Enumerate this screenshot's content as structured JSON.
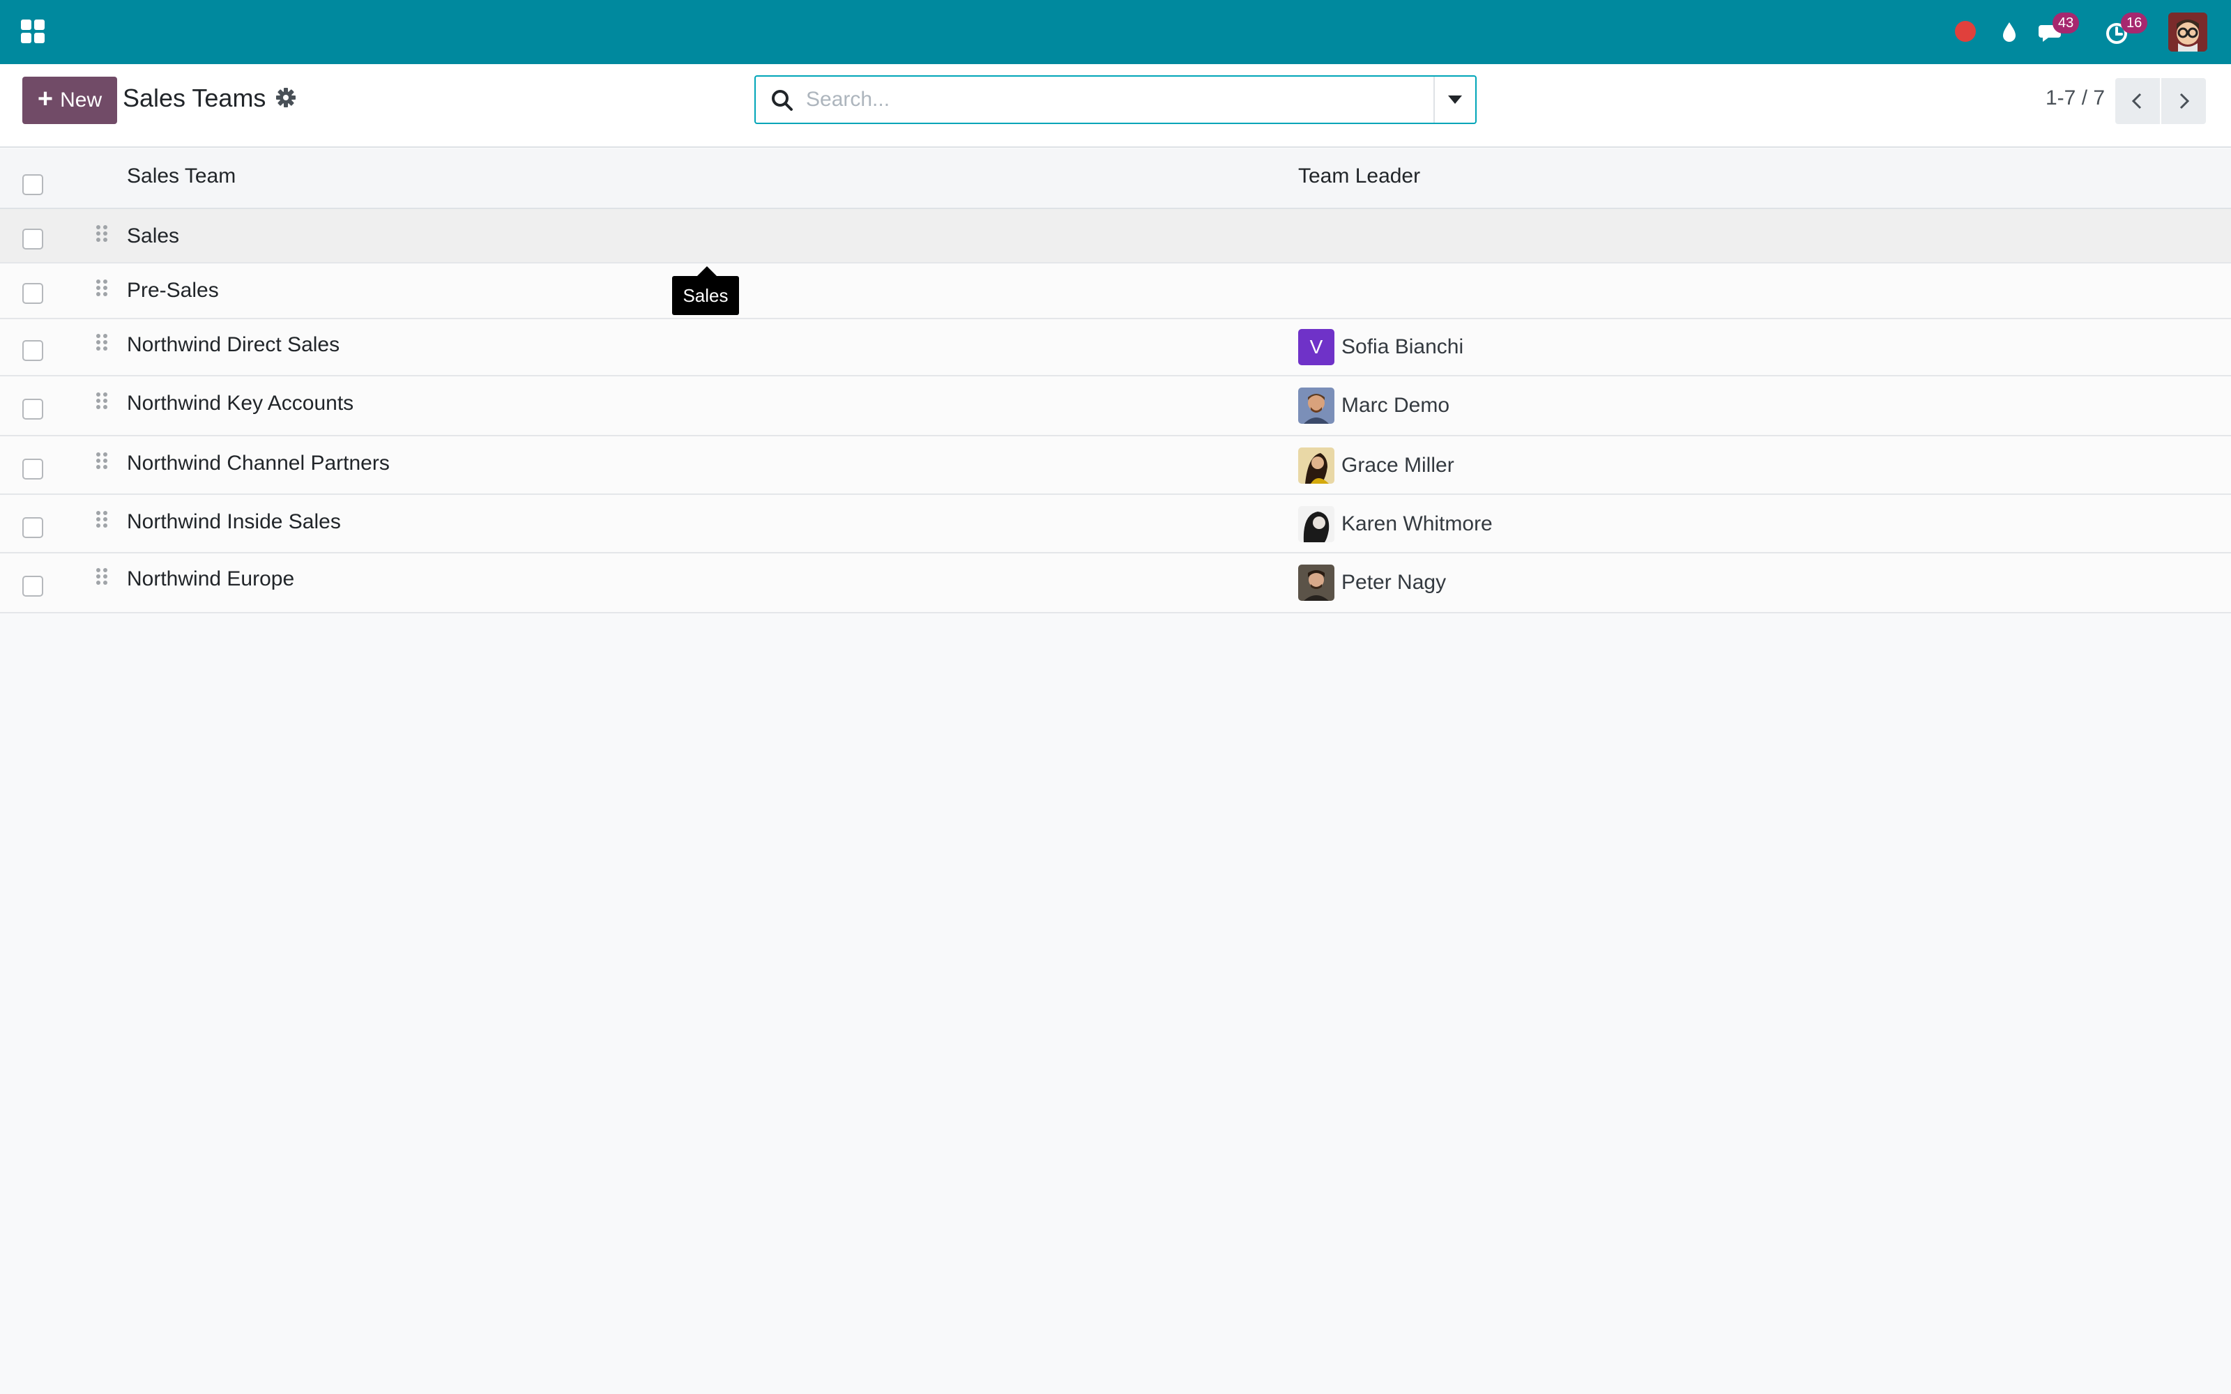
{
  "navbar": {
    "icons": [
      "apps-icon",
      "recording-icon",
      "water-drop-icon",
      "chat-icon",
      "activity-clock-icon",
      "user-avatar"
    ],
    "messages_count": "43",
    "activities_count": "16",
    "accent_color": "#00899e",
    "badge_color": "#a6286f"
  },
  "control_panel": {
    "new_label": "New",
    "title": "Sales Teams",
    "search_placeholder": "Search...",
    "pager": "1-7 / 7",
    "primary_color": "#714b67"
  },
  "list": {
    "columns": [
      "Sales Team",
      "Team Leader"
    ],
    "rows": [
      {
        "name": "Sales",
        "leader": ""
      },
      {
        "name": "Pre-Sales",
        "leader": ""
      },
      {
        "name": "Northwind Direct Sales",
        "leader": "Sofia Bianchi",
        "avatar_initial": "V"
      },
      {
        "name": "Northwind Key Accounts",
        "leader": "Marc Demo"
      },
      {
        "name": "Northwind Channel Partners",
        "leader": "Grace Miller"
      },
      {
        "name": "Northwind Inside Sales",
        "leader": "Karen Whitmore"
      },
      {
        "name": "Northwind Europe",
        "leader": "Peter Nagy"
      }
    ]
  },
  "tooltip": {
    "text": "Sales"
  }
}
